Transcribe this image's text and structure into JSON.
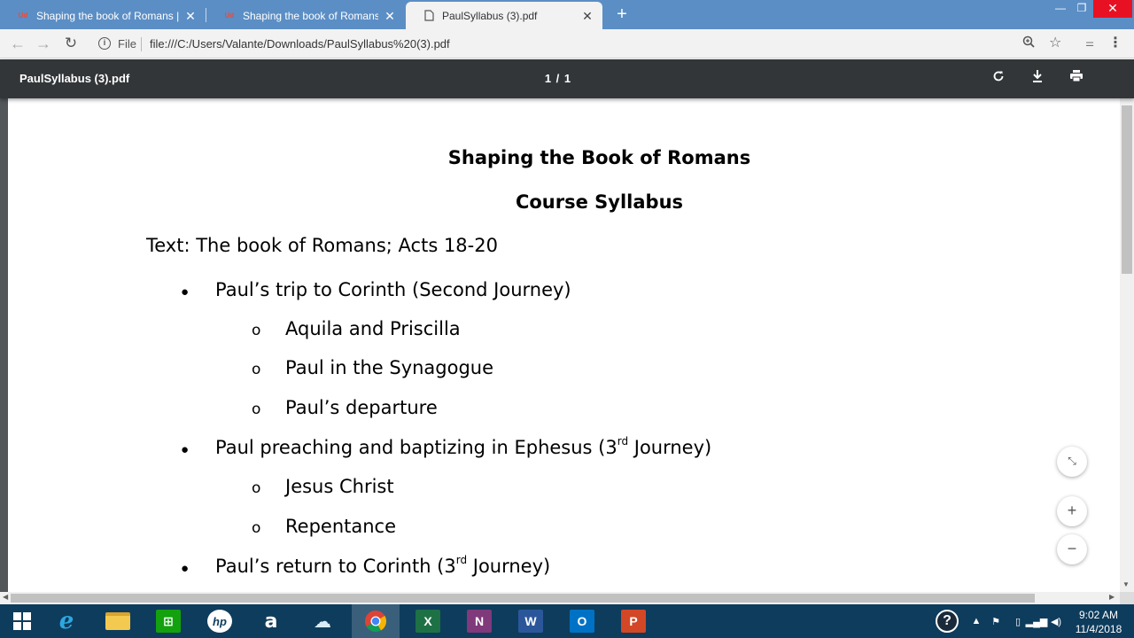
{
  "browser": {
    "tabs": [
      {
        "title": "Shaping the book of Romans | U",
        "favicon": "udemy-icon",
        "active": false
      },
      {
        "title": "Shaping the book of Romans | U",
        "favicon": "udemy-icon",
        "active": false
      },
      {
        "title": "PaulSyllabus (3).pdf",
        "favicon": "document-icon",
        "active": true
      }
    ],
    "new_tab": "+",
    "address": {
      "scheme_label": "File",
      "url": "file:///C:/Users/Valante/Downloads/PaulSyllabus%20(3).pdf"
    }
  },
  "pdf_viewer": {
    "filename": "PaulSyllabus (3).pdf",
    "page_indicator": "1 / 1"
  },
  "document": {
    "title": "Shaping the Book of Romans",
    "subtitle": "Course Syllabus",
    "text_line": "Text: The book of Romans; Acts 18-20",
    "sections": [
      {
        "heading": "Paul’s trip to Corinth (Second Journey)",
        "items": [
          "Aquila and Priscilla",
          "Paul in the Synagogue",
          "Paul’s departure"
        ]
      },
      {
        "heading_pre": "Paul preaching and baptizing in Ephesus (3",
        "heading_sup": "rd",
        "heading_post": " Journey)",
        "items": [
          "Jesus Christ",
          "Repentance"
        ]
      },
      {
        "heading_pre": "Paul’s return to Corinth (3",
        "heading_sup": "rd",
        "heading_post": " Journey)",
        "items": []
      }
    ],
    "bullet": "●",
    "sub_bullet": "o"
  },
  "taskbar": {
    "time": "9:02 AM",
    "date": "11/4/2018",
    "apps": [
      "start",
      "internet-explorer",
      "file-explorer",
      "store",
      "hp",
      "amazon",
      "onedrive",
      "chrome",
      "excel",
      "onenote",
      "word",
      "outlook",
      "powerpoint"
    ]
  }
}
